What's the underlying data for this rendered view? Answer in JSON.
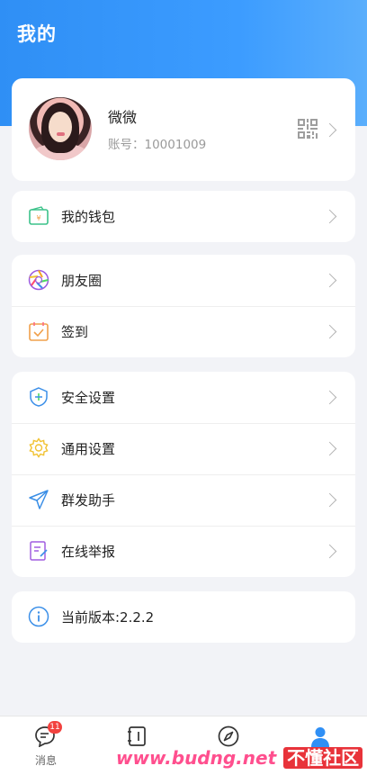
{
  "header": {
    "title": "我的"
  },
  "profile": {
    "nickname": "微微",
    "account": "账号：10001009",
    "avatar_icon": "user-avatar-photo",
    "qr_icon": "qr-code-icon"
  },
  "groups": {
    "wallet": [
      {
        "label": "我的钱包",
        "icon": "wallet-icon",
        "color": "#3cc28a"
      }
    ],
    "social": [
      {
        "label": "朋友圈",
        "icon": "moments-aperture-icon",
        "color": "#f5a623"
      },
      {
        "label": "签到",
        "icon": "calendar-check-icon",
        "color": "#f0a04b"
      }
    ],
    "settings": [
      {
        "label": "安全设置",
        "icon": "shield-icon",
        "color": "#3b8fe8"
      },
      {
        "label": "通用设置",
        "icon": "gear-icon",
        "color": "#f1c232"
      },
      {
        "label": "群发助手",
        "icon": "paper-plane-icon",
        "color": "#3a8ee6"
      },
      {
        "label": "在线举报",
        "icon": "report-edit-icon",
        "color": "#a05de0"
      }
    ],
    "version": [
      {
        "label": "当前版本:2.2.2",
        "icon": "info-icon",
        "color": "#3b8fe8"
      }
    ]
  },
  "tabbar": {
    "tabs": [
      {
        "label": "消息",
        "icon": "message-bubble-icon",
        "badge": "11"
      },
      {
        "label": "",
        "icon": "address-book-icon"
      },
      {
        "label": "",
        "icon": "compass-icon"
      },
      {
        "label": "",
        "icon": "person-icon",
        "active": true
      }
    ]
  },
  "watermark": {
    "domain": "www.budng.net",
    "cn": "不懂社区"
  },
  "colors": {
    "primary": "#2f8ff5",
    "background": "#f2f3f7",
    "badge": "#f2423f"
  }
}
